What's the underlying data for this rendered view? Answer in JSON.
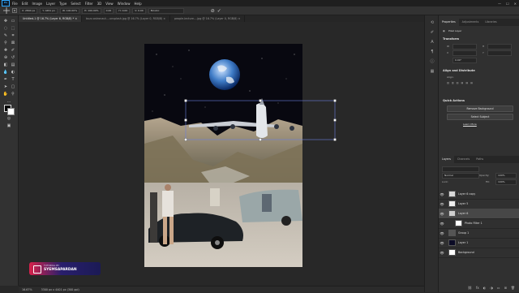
{
  "app": {
    "logo_text": "Ps"
  },
  "menu": {
    "items": [
      "File",
      "Edit",
      "Image",
      "Layer",
      "Type",
      "Select",
      "Filter",
      "3D",
      "View",
      "Window",
      "Help"
    ]
  },
  "window_controls": {
    "minimize": "—",
    "maximize": "☐",
    "close": "✕"
  },
  "options_bar": {
    "x": "X: 2894 px",
    "y": "Y: 4451 px",
    "w": "W: 100.00%",
    "h": "H: 100.00%",
    "angle": "0.00",
    "h_skew": "H: 0.00",
    "v_skew": "V: 0.00",
    "interpolation": "Bicubic",
    "cancel_symbol": "⊘",
    "commit_symbol": "✓"
  },
  "tabs": [
    {
      "label": "Untitled-1 @ 16.7% (Layer 6, RGB/8) *",
      "close": "×",
      "active": true
    },
    {
      "label": "buzz-astronaut...-unsplash.jpg @ 16.7% (Layer 0, RGB/8)",
      "close": "×",
      "active": false
    },
    {
      "label": "people-lecture-...jpg @ 16.7% (Layer 0, RGB/8)",
      "close": "×",
      "active": false
    }
  ],
  "status_bar": {
    "zoom": "16.67%",
    "doc_size": "3300 px x 4401 px (300 ppi)"
  },
  "properties": {
    "tabs": [
      "Properties",
      "Adjustments",
      "Libraries"
    ],
    "kind": "Pixel Layer",
    "transform_title": "Transform",
    "transform_fields": [
      "W",
      "H",
      "X",
      "Y"
    ],
    "angle_value": "0.00°",
    "align_title": "Align and Distribute",
    "align_label": "Align:",
    "quick_actions_title": "Quick Actions",
    "buttons": [
      "Remove Background",
      "Select Subject"
    ],
    "learn_more": "Learn More"
  },
  "layers_panel": {
    "tabs": [
      "Layers",
      "Channels",
      "Paths"
    ],
    "blend_mode": "Normal",
    "opacity_label": "Opacity:",
    "opacity_value": "100%",
    "lock_label": "Lock:",
    "fill_label": "Fill:",
    "fill_value": "100%",
    "layers": [
      {
        "name": "Layer 6 copy",
        "selected": false,
        "thumb": "#d8d8d8"
      },
      {
        "name": "Layer 5",
        "selected": false,
        "thumb": "#eeeeee"
      },
      {
        "name": "Layer 6",
        "selected": true,
        "thumb": "#cfcfcf"
      },
      {
        "name": "Photo Filter 1",
        "selected": false,
        "thumb": "#ffffff"
      },
      {
        "name": "Group 1",
        "selected": false,
        "thumb": "#555555"
      },
      {
        "name": "Layer 1",
        "selected": false,
        "thumb": "#0b0b25"
      },
      {
        "name": "Background",
        "selected": false,
        "thumb": "#ffffff"
      }
    ],
    "footer_icons": [
      "link-icon",
      "fx-icon",
      "mask-icon",
      "adjustment-icon",
      "folder-icon",
      "new-layer-icon",
      "trash-icon"
    ]
  },
  "overlay": {
    "line1": "TUTORIAL BY",
    "line2": "SYEMSAPARDAN"
  },
  "colors": {
    "accent": "#31a8ff",
    "transform_handles": "#ffffff",
    "selection_box": "#6a7fe0"
  }
}
